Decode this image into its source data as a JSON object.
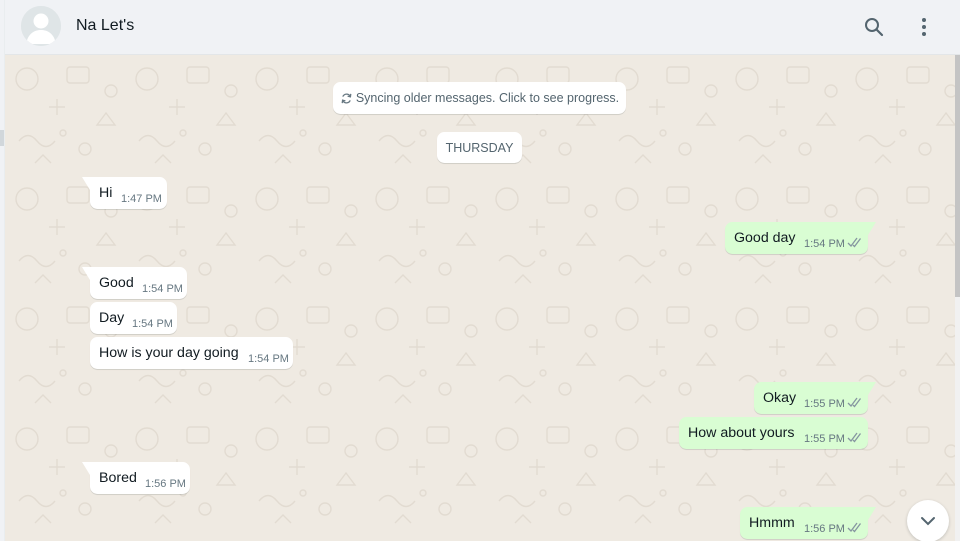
{
  "header": {
    "contact_name": "Na Let's",
    "icons": [
      "avatar-placeholder",
      "search-icon",
      "menu-icon"
    ]
  },
  "chat": {
    "sync_notice": "Syncing older messages. Click to see progress.",
    "day_separator": "THURSDAY",
    "messages": [
      {
        "direction": "in",
        "text": "Hi",
        "time": "1:47 PM"
      },
      {
        "direction": "out",
        "text": "Good day",
        "time": "1:54 PM",
        "status": "read"
      },
      {
        "direction": "in",
        "text": "Good",
        "time": "1:54 PM"
      },
      {
        "direction": "in",
        "text": "Day",
        "time": "1:54 PM"
      },
      {
        "direction": "in",
        "text": "How is your day going",
        "time": "1:54 PM"
      },
      {
        "direction": "out",
        "text": "Okay",
        "time": "1:55 PM",
        "status": "read"
      },
      {
        "direction": "out",
        "text": "How about yours",
        "time": "1:55 PM",
        "status": "read"
      },
      {
        "direction": "in",
        "text": "Bored",
        "time": "1:56 PM"
      },
      {
        "direction": "out",
        "text": "Hmmm",
        "time": "1:56 PM",
        "status": "read"
      }
    ]
  },
  "colors": {
    "header_bg": "#f0f2f5",
    "chat_bg": "#efeae2",
    "incoming_bubble": "#ffffff",
    "outgoing_bubble": "#d9fdd3",
    "read_ticks": "#8696a0"
  }
}
